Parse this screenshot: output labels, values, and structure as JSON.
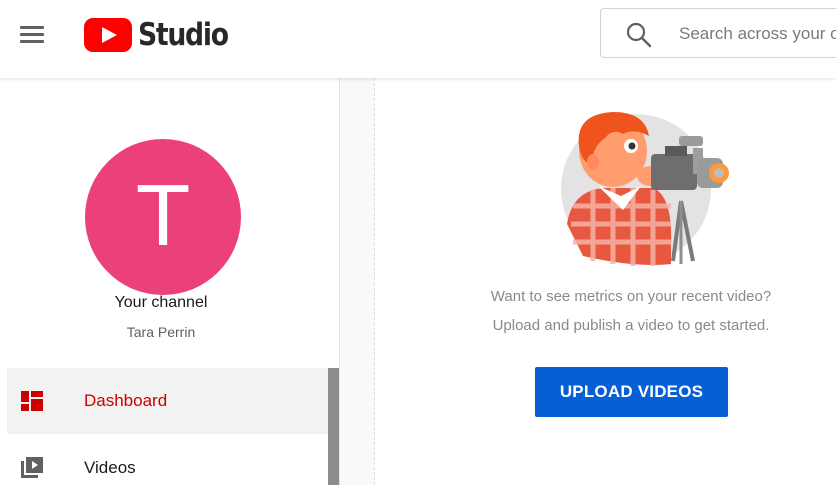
{
  "header": {
    "logo_text": "Studio",
    "search_placeholder": "Search across your channel"
  },
  "sidebar": {
    "avatar_letter": "T",
    "channel_title": "Your channel",
    "channel_name": "Tara Perrin",
    "items": [
      {
        "label": "Dashboard",
        "icon": "dashboard-icon",
        "active": true
      },
      {
        "label": "Videos",
        "icon": "videos-icon",
        "active": false
      }
    ]
  },
  "main": {
    "empty_line1": "Want to see metrics on your recent video?",
    "empty_line2": "Upload and publish a video to get started.",
    "upload_label": "UPLOAD VIDEOS"
  },
  "colors": {
    "brand_red": "#ff0000",
    "avatar_pink": "#ec407a",
    "active_red": "#cc0000",
    "button_blue": "#065fd4"
  }
}
